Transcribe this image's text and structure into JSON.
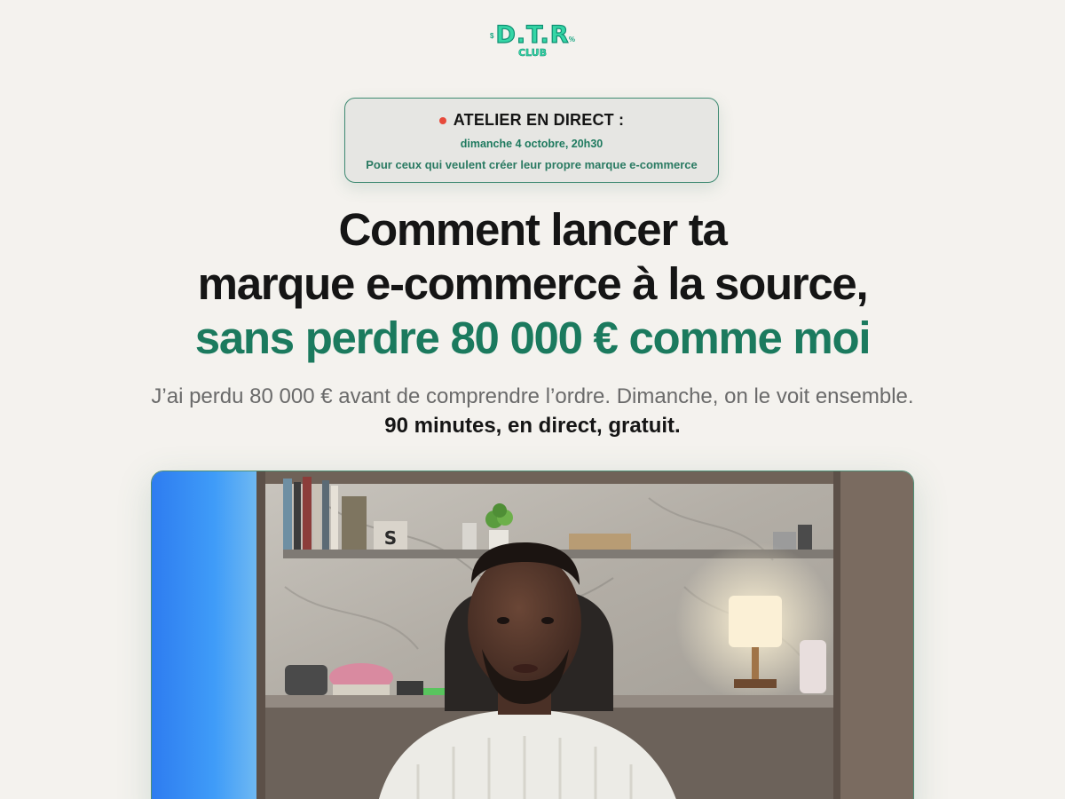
{
  "logo": {
    "main": "D.T.R",
    "sub": "CLUB"
  },
  "event": {
    "title": "ATELIER EN DIRECT :",
    "date": "dimanche 4 octobre, 20h30",
    "audience": "Pour ceux qui veulent créer leur propre marque e-commerce"
  },
  "headline": {
    "line1": "Comment lancer ta",
    "line2": "marque e-commerce à la source,",
    "line3": "sans perdre 80 000 € comme moi"
  },
  "subtext": {
    "text": "J’ai perdu 80 000 € avant de comprendre l’ordre. Dimanche, on le voit ensemble. ",
    "emphasis": "90 minutes, en direct, gratuit."
  },
  "video": {
    "shelf_letter": "S"
  },
  "colors": {
    "background": "#f4f2ee",
    "accent_green": "#1b7a5e",
    "live_red": "#e74a3b",
    "logo_mint": "#35d6a6"
  }
}
